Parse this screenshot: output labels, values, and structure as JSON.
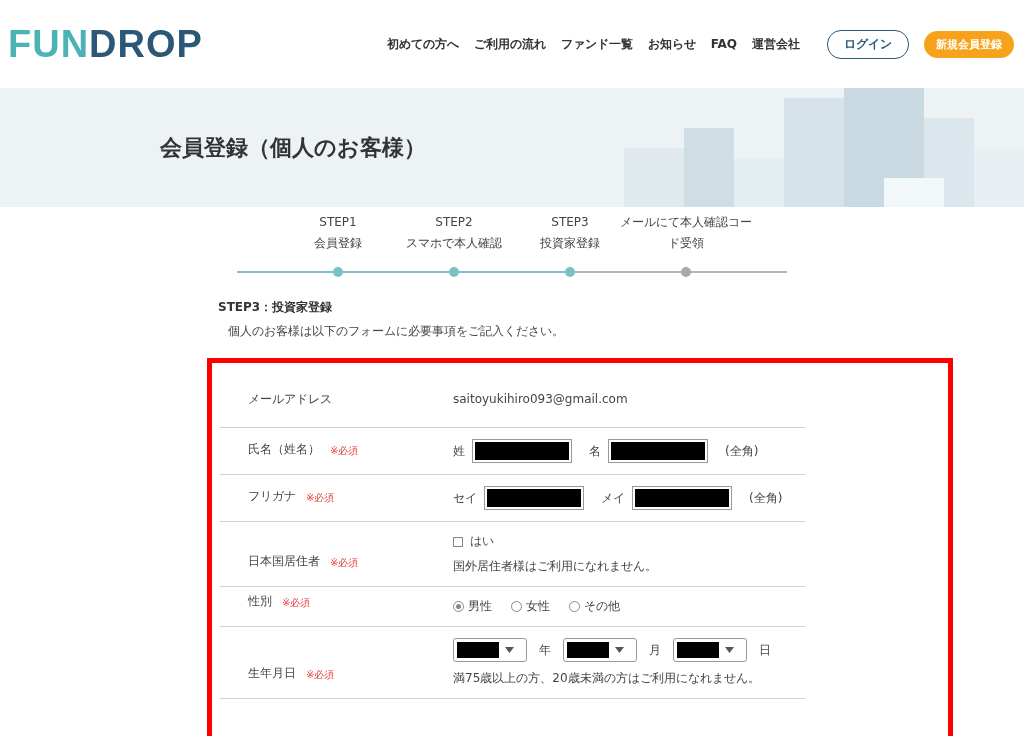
{
  "logo": {
    "text": "FUNDROP"
  },
  "nav": {
    "items": [
      "初めての方へ",
      "ご利用の流れ",
      "ファンド一覧",
      "お知らせ",
      "FAQ",
      "運営会社"
    ],
    "login": "ログイン",
    "register": "新規会員登録"
  },
  "hero": {
    "title": "会員登録（個人のお客様）"
  },
  "steps": [
    {
      "name": "STEP1",
      "label": "会員登録",
      "done": true
    },
    {
      "name": "STEP2",
      "label": "スマホで本人確認",
      "done": true
    },
    {
      "name": "STEP3",
      "label": "投資家登録",
      "done": true
    },
    {
      "label": "メールにて本人確認コード受領",
      "done": false
    }
  ],
  "intro": {
    "heading": "STEP3：投資家登録",
    "text": "個人のお客様は以下のフォームに必要事項をご記入ください。"
  },
  "form": {
    "rows": [
      {
        "kind": "text",
        "label": "メールアドレス",
        "value": "saitoyukihiro093@gmail.com"
      },
      {
        "kind": "fields",
        "label": "氏名（姓名）",
        "required": "※必須",
        "fields": [
          {
            "label": "姓",
            "redacted": true
          },
          {
            "label": "名",
            "redacted": true
          }
        ],
        "note": "(全角)"
      },
      {
        "kind": "fields",
        "label": "フリガナ",
        "required": "※必須",
        "fields": [
          {
            "label": "セイ",
            "redacted": true
          },
          {
            "label": "メイ",
            "redacted": true
          }
        ],
        "note": "(全角)"
      },
      {
        "kind": "checkbox",
        "label": "日本国居住者",
        "required": "※必須",
        "option": "はい",
        "checked": false,
        "help": "国外居住者様はご利用になれません。"
      },
      {
        "kind": "radio",
        "label": "性別",
        "required": "※必須",
        "options": [
          {
            "label": "男性",
            "selected": true
          },
          {
            "label": "女性",
            "selected": false
          },
          {
            "label": "その他",
            "selected": false
          }
        ]
      },
      {
        "kind": "date",
        "label": "生年月日",
        "required": "※必須",
        "selects": [
          {
            "suffix": "年",
            "redacted": true
          },
          {
            "suffix": "月",
            "redacted": true
          },
          {
            "suffix": "日",
            "redacted": true
          }
        ],
        "help": "満75歳以上の方、20歳未満の方はご利用になれません。"
      }
    ]
  }
}
